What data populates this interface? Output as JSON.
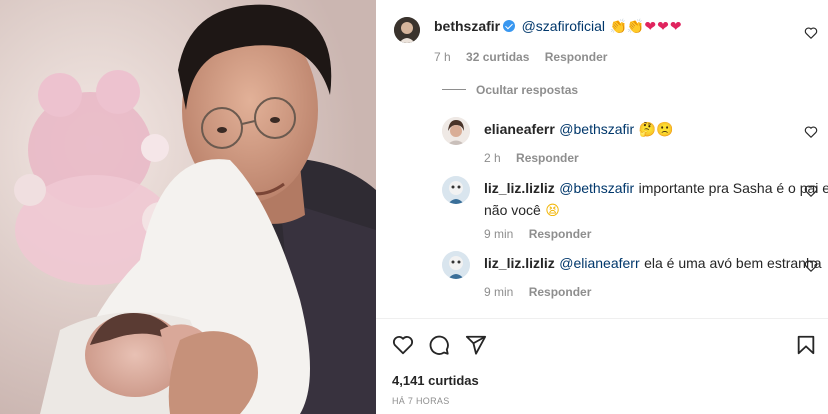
{
  "post": {
    "likes_text": "4,141 curtidas",
    "time_ago": "HÁ 7 HORAS"
  },
  "comments": [
    {
      "user": "bethszafir",
      "verified": true,
      "mention": "@szafiroficial",
      "text": "",
      "emoji": "👏👏❤❤❤",
      "time": "7 h",
      "likes": "32 curtidas",
      "reply": "Responder"
    },
    {
      "toggle": "Ocultar respostas"
    },
    {
      "user": "elianeaferr",
      "mention": "@bethszafir",
      "text": "",
      "emoji": "🤔🙁",
      "time": "2 h",
      "reply": "Responder"
    },
    {
      "user": "liz_liz.lizliz",
      "mention": "@bethszafir",
      "text": "importante pra Sasha é o pai e",
      "text2": "não você",
      "emoji": "😫",
      "time": "9 min",
      "reply": "Responder"
    },
    {
      "user": "liz_liz.lizliz",
      "mention": "@elianeaferr",
      "text": "ela é uma avó bem estranha",
      "time": "9 min",
      "reply": "Responder"
    }
  ],
  "icons": {
    "like": "heart-outline-icon",
    "comment": "comment-icon",
    "share": "paper-plane-icon",
    "save": "bookmark-icon",
    "comment_like": "heart-small-icon"
  },
  "colors": {
    "mention": "#00376b",
    "meta": "#8e8e8e",
    "verified": "#3897f0",
    "heart": "#e0245e"
  }
}
